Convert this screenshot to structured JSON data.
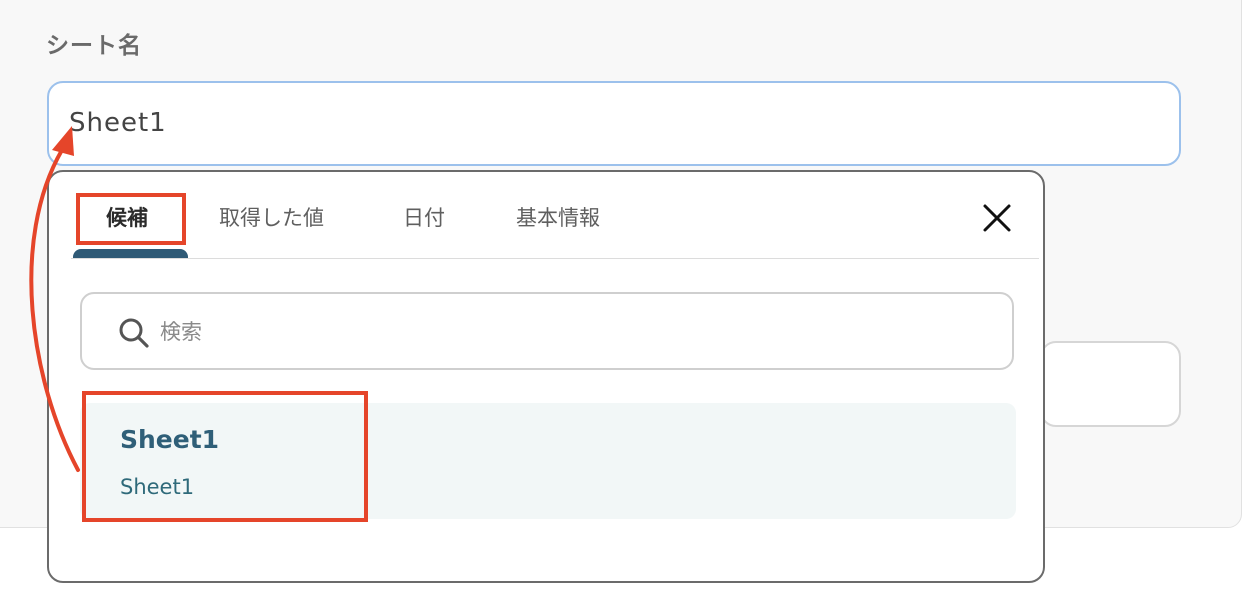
{
  "field": {
    "label": "シート名",
    "value": "Sheet1"
  },
  "popup": {
    "tabs": [
      {
        "label": "候補",
        "active": true
      },
      {
        "label": "取得した値",
        "active": false
      },
      {
        "label": "日付",
        "active": false
      },
      {
        "label": "基本情報",
        "active": false
      }
    ],
    "close_icon": "close-icon",
    "search": {
      "placeholder": "検索",
      "icon": "search-icon"
    },
    "results": [
      {
        "title": "Sheet1",
        "subtitle": "Sheet1"
      }
    ]
  },
  "colors": {
    "accent": "#2f5a76",
    "annotation": "#e5452a",
    "focus_border": "#9cc1ec"
  }
}
